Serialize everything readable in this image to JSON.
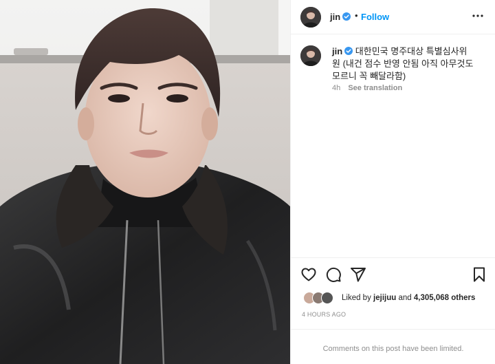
{
  "post": {
    "username": "jin",
    "verified": true,
    "follow_label": "Follow",
    "header_separator": "•",
    "more_icon": "more-horizontal-icon",
    "caption_line1": "대한민국 명주대상 특별심사위",
    "caption_line2": "원 (내건 점수 반영 안됨 아직 아무것도",
    "caption_line3": "모르니 꼭 빼달라함)",
    "caption_age": "4h",
    "see_translation": "See translation",
    "liked_by_prefix": "Liked by",
    "liked_by_user": "jejijuu",
    "liked_by_and": "and",
    "likes_count": "4,305,068 others",
    "timestamp": "4 hours ago",
    "comments_limited": "Comments on this post have been limited."
  },
  "actions": [
    {
      "icon": "heart-icon"
    },
    {
      "icon": "comment-icon"
    },
    {
      "icon": "share-icon"
    },
    {
      "icon": "bookmark-icon"
    }
  ],
  "colors": {
    "link_blue": "#0095f6",
    "verified_blue": "#3897f0",
    "muted": "#8e8e8e",
    "text": "#262626",
    "divider": "#efefef"
  }
}
